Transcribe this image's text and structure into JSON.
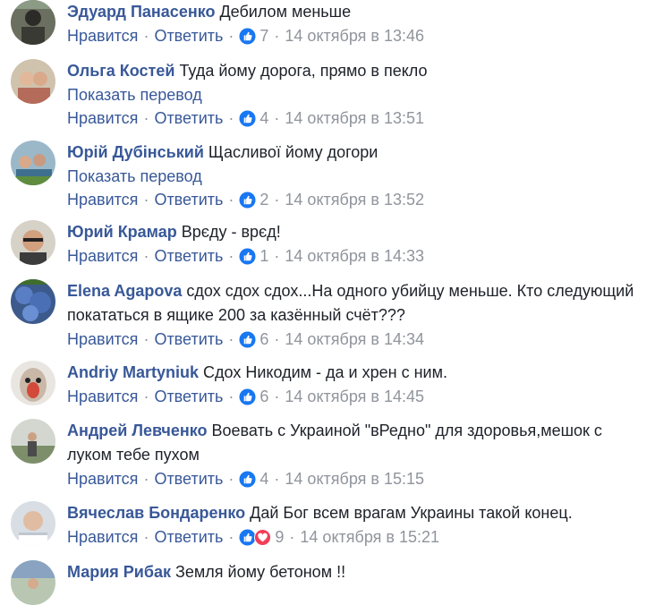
{
  "ui": {
    "like_label": "Нравится",
    "reply_label": "Ответить",
    "separator": "·",
    "translate_label": "Показать перевод",
    "like_icon": "thumbs-up-icon",
    "love_icon": "heart-icon",
    "colors": {
      "link": "#385898",
      "meta": "#90949c",
      "text": "#1d2129",
      "like_blue": "#1877f2",
      "love_red": "#f33e58"
    }
  },
  "comments": [
    {
      "author": "Эдуард Панасенко",
      "text": "Дебилом меньше",
      "likes": "7",
      "time": "14 октября в 13:46"
    },
    {
      "author": "Ольга Костей",
      "text": "Туда йому дорога, прямо в пекло",
      "translate": true,
      "likes": "4",
      "time": "14 октября в 13:51"
    },
    {
      "author": "Юрій Дубінський",
      "text": "Щасливої йому догори",
      "translate": true,
      "likes": "2",
      "time": "14 октября в 13:52"
    },
    {
      "author": "Юрий Крамар",
      "text": "Врєду - врєд!",
      "likes": "1",
      "time": "14 октября в 14:33"
    },
    {
      "author": "Elena Agapova",
      "text": "сдох сдох сдох...На одного убийцу меньше. Кто следующий покататься в ящике 200 за казённый счёт???",
      "likes": "6",
      "time": "14 октября в 14:34"
    },
    {
      "author": "Andriy Martyniuk",
      "text": "Сдох Никодим - да и хрен с ним.",
      "likes": "6",
      "time": "14 октября в 14:45"
    },
    {
      "author": "Андрей Левченко",
      "text": "Воевать с Украиной \"вРедно\" для здоровья,мешок с луком тебе пухом",
      "likes": "4",
      "time": "14 октября в 15:15"
    },
    {
      "author": "Вячеслав Бондаренко",
      "text": "Дай Бог всем врагам Украины такой конец.",
      "likes": "9",
      "love": true,
      "time": "14 октября в 15:21"
    },
    {
      "author": "Мария Рибак",
      "text": "Земля йому бетоном !!"
    }
  ]
}
